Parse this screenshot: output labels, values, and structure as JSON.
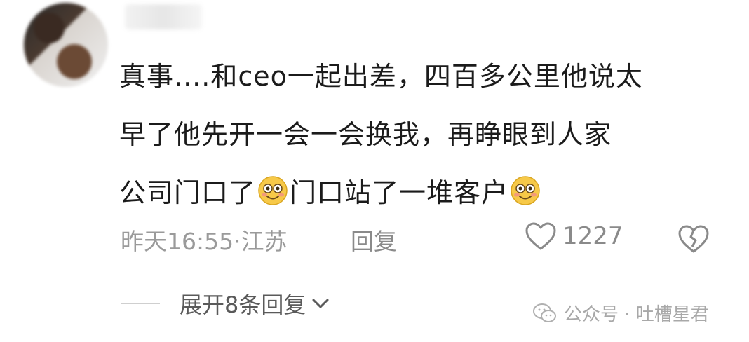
{
  "comment": {
    "lines": [
      "真事....和ceo一起出差，四百多公里他说太",
      "早了他先开一会一会换我，再睁眼到人家",
      "公司门口了",
      "门口站了一堆客户"
    ]
  },
  "meta": {
    "time": "昨天16:55",
    "sep": " · ",
    "location": "江苏",
    "reply_label": "回复"
  },
  "like": {
    "count": "1227",
    "icon": "heart-outline-icon"
  },
  "dislike": {
    "icon": "broken-heart-icon"
  },
  "expand": {
    "label": "展开8条回复",
    "icon": "chevron-down-icon"
  },
  "watermark": {
    "text": "公众号 · 吐槽星君",
    "icon": "wechat-icon"
  },
  "colors": {
    "text": "#1b1b1b",
    "muted": "#9a9a9a",
    "emoji": "#f7c948"
  }
}
